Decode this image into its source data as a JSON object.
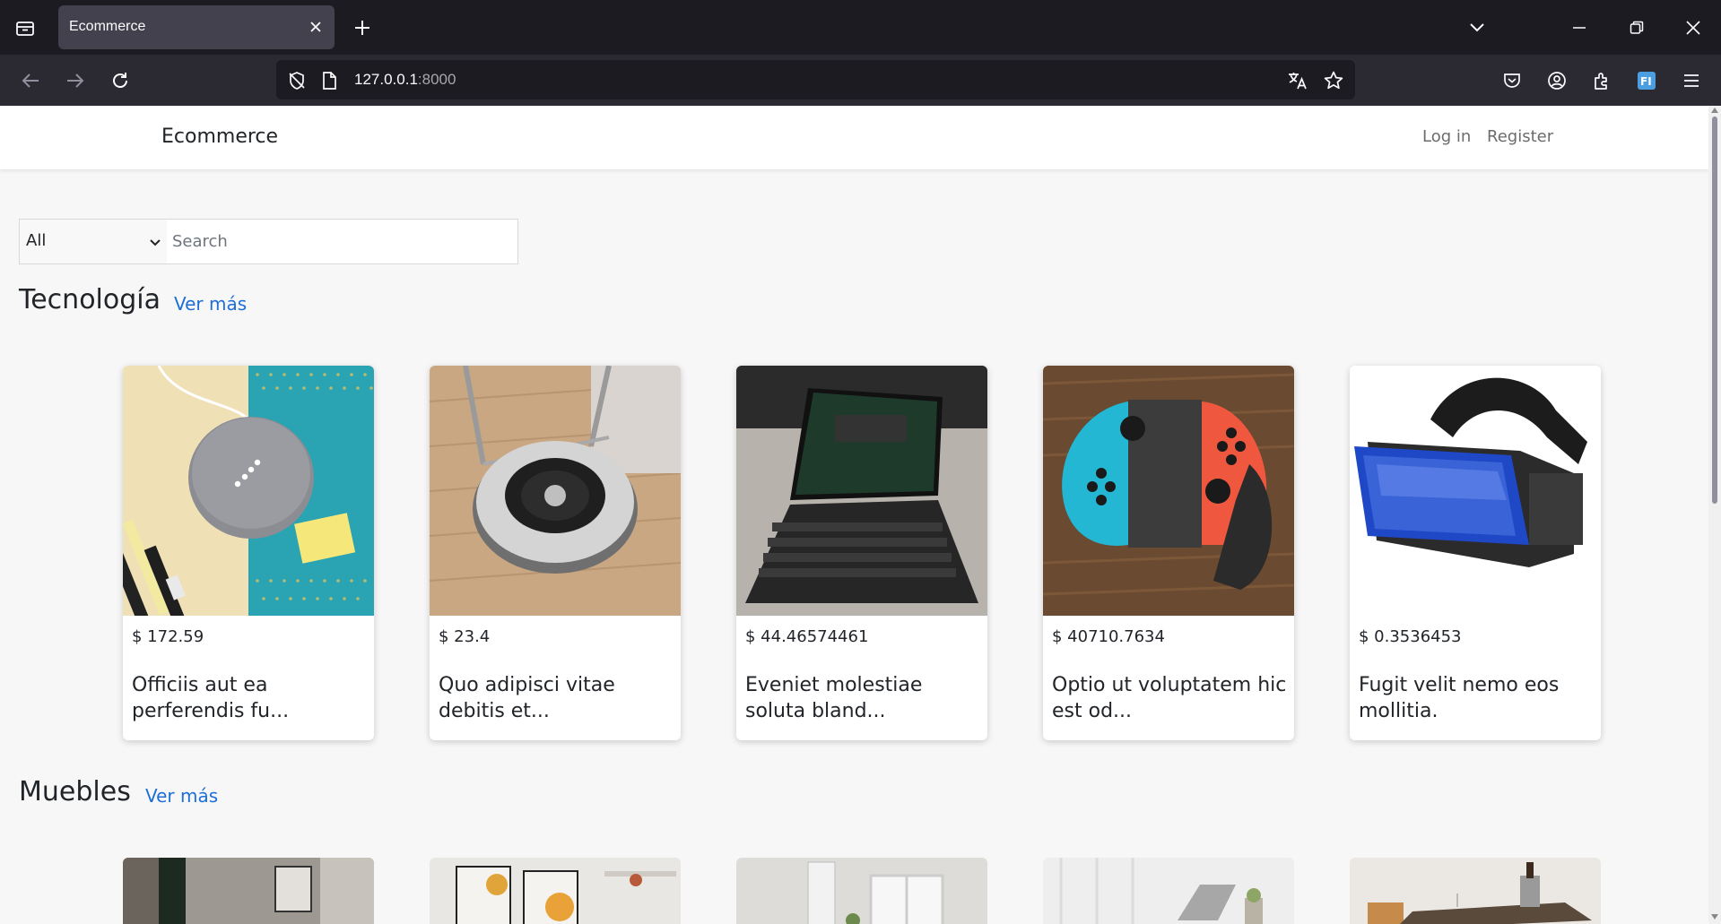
{
  "browser": {
    "tab_title": "Ecommerce",
    "url_host": "127.0.0.1",
    "url_port": ":8000"
  },
  "site": {
    "brand": "Ecommerce",
    "login": "Log in",
    "register": "Register"
  },
  "search": {
    "category_value": "All",
    "placeholder": "Search"
  },
  "sections": [
    {
      "title": "Tecnología",
      "see_more": "Ver más",
      "products": [
        {
          "price": "$ 172.59",
          "name": "Officiis aut ea perferendis fu...",
          "image": "smart-speaker-image"
        },
        {
          "price": "$ 23.4",
          "name": "Quo adipisci vitae debitis et...",
          "image": "robot-vacuum-image"
        },
        {
          "price": "$ 44.46574461",
          "name": "Eveniet molestiae soluta bland...",
          "image": "tablet-keyboard-image"
        },
        {
          "price": "$ 40710.7634",
          "name": "Optio ut voluptatem hic est od...",
          "image": "game-controller-image"
        },
        {
          "price": "$ 0.3536453",
          "name": "Fugit velit nemo eos mollitia.",
          "image": "vr-headset-image"
        }
      ]
    },
    {
      "title": "Muebles",
      "see_more": "Ver más",
      "products": [
        {
          "image": "furniture-room-image-1"
        },
        {
          "image": "furniture-room-image-2"
        },
        {
          "image": "furniture-room-image-3"
        },
        {
          "image": "furniture-room-image-4"
        },
        {
          "image": "furniture-room-image-5"
        }
      ]
    }
  ],
  "colors": {
    "link": "#1d6fd6",
    "chrome_dark": "#1c1b22",
    "chrome_toolbar": "#2b2a33"
  }
}
